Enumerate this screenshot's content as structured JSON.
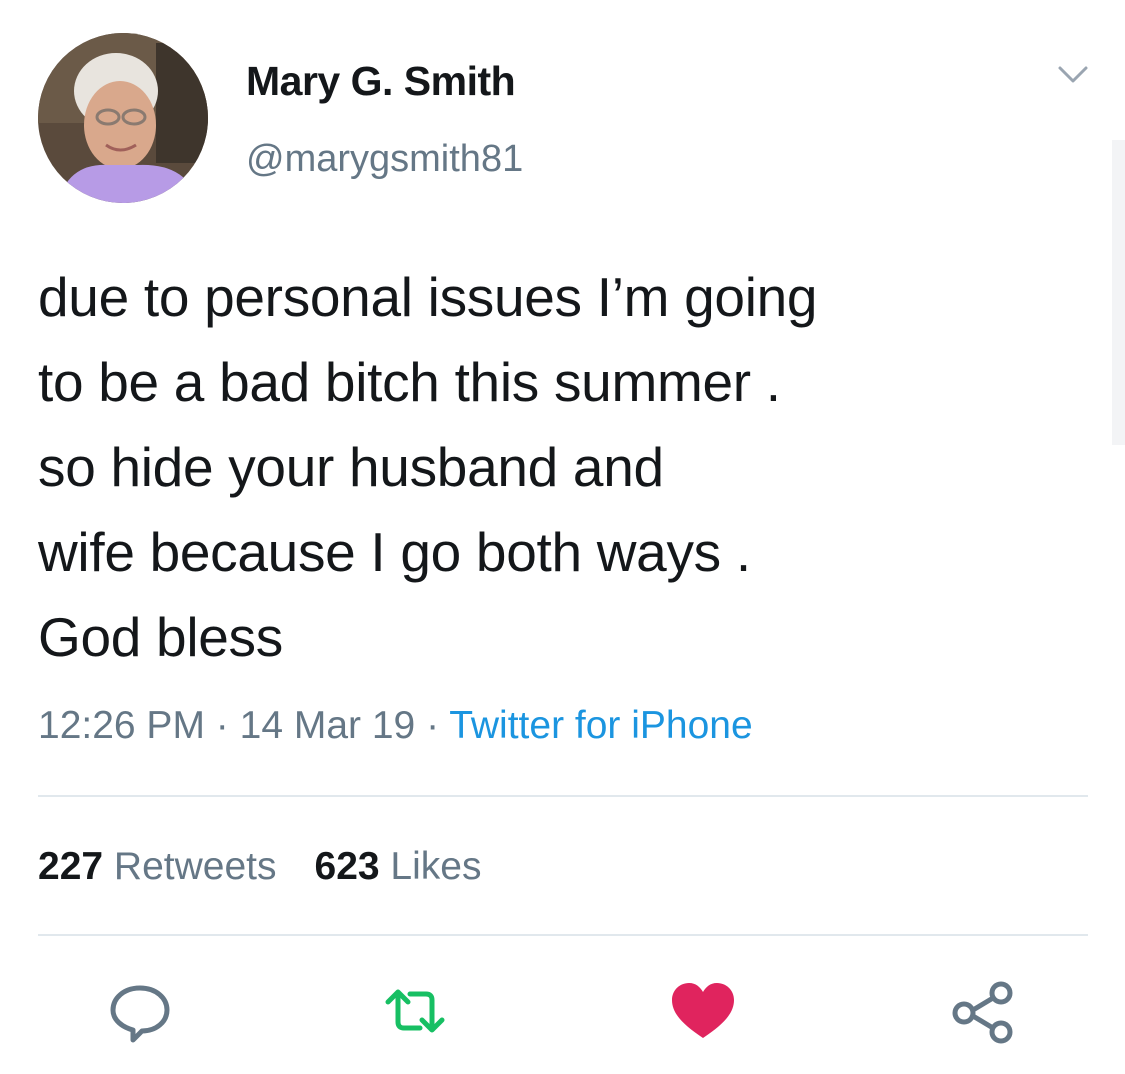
{
  "user": {
    "display_name": "Mary G. Smith",
    "handle": "@marygsmith81"
  },
  "tweet": {
    "lines": [
      "due to personal issues I’m going",
      "to be a bad bitch this summer .",
      "so hide your husband and",
      "wife because I go both ways .",
      "God bless"
    ],
    "time": "12:26 PM",
    "date": "14 Mar 19",
    "source": "Twitter for iPhone",
    "separator": "·"
  },
  "stats": {
    "retweets_count": "227",
    "retweets_label": "Retweets",
    "likes_count": "623",
    "likes_label": "Likes"
  },
  "actions": [
    {
      "name": "reply",
      "icon": "reply-icon",
      "color": "#657786"
    },
    {
      "name": "retweet",
      "icon": "retweet-icon",
      "color": "#17bf63",
      "active": true
    },
    {
      "name": "like",
      "icon": "heart-icon",
      "color": "#e0245e",
      "active": true
    },
    {
      "name": "share",
      "icon": "share-icon",
      "color": "#657786"
    }
  ],
  "colors": {
    "text": "#14171a",
    "muted": "#657786",
    "link": "#1b95e0",
    "retweet": "#17bf63",
    "like": "#e0245e",
    "divider": "#e1e8ed"
  }
}
